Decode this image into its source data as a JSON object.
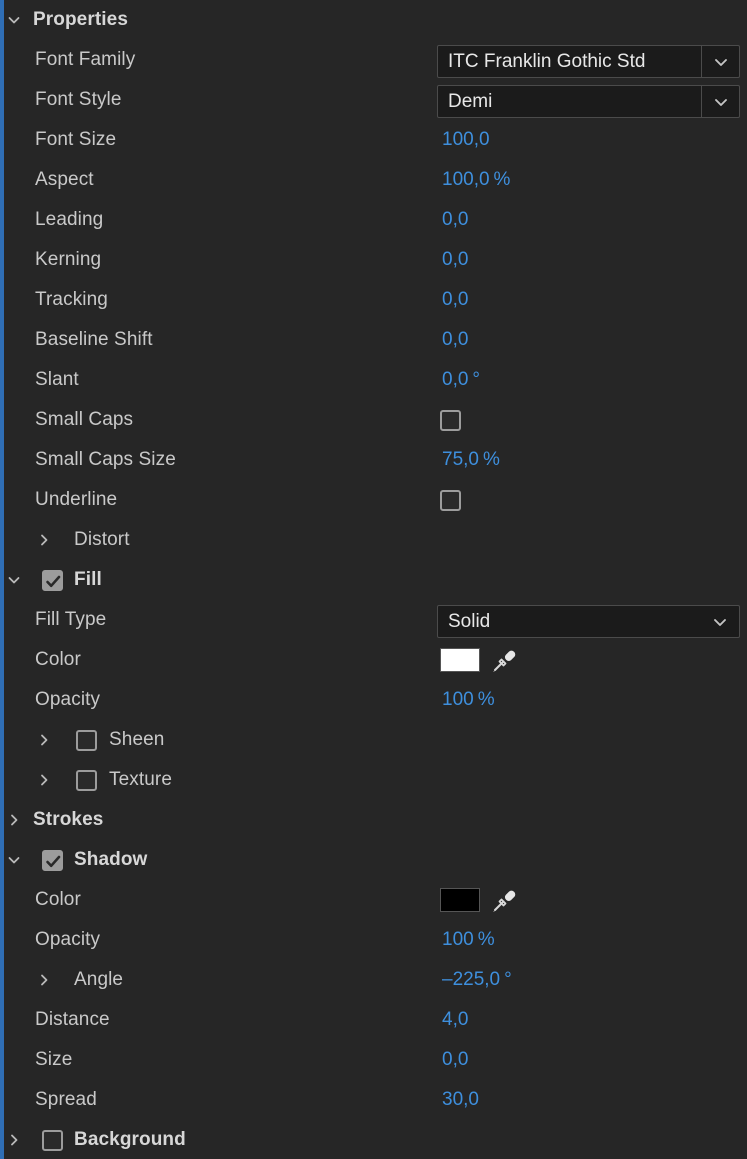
{
  "panel": {
    "title": "Properties",
    "accent_color": "#2f6eb5",
    "background_color": "#262626",
    "value_color": "#3e8fdd",
    "label_color": "#c9c9c9"
  },
  "rows": [
    {
      "label": "Properties",
      "kind": "section-header",
      "expanded": true,
      "chevron": "chevron-down-icon"
    },
    {
      "label": "Font Family",
      "kind": "dropdown",
      "value": "ITC Franklin Gothic Std",
      "split": true
    },
    {
      "label": "Font Style",
      "kind": "dropdown",
      "value": "Demi",
      "split": true
    },
    {
      "label": "Font Size",
      "kind": "value",
      "value": "100,0"
    },
    {
      "label": "Aspect",
      "kind": "value",
      "value": "100,0",
      "unit": "%"
    },
    {
      "label": "Leading",
      "kind": "value",
      "value": "0,0"
    },
    {
      "label": "Kerning",
      "kind": "value",
      "value": "0,0"
    },
    {
      "label": "Tracking",
      "kind": "value",
      "value": "0,0"
    },
    {
      "label": "Baseline Shift",
      "kind": "value",
      "value": "0,0"
    },
    {
      "label": "Slant",
      "kind": "value",
      "value": "0,0",
      "unit": "°"
    },
    {
      "label": "Small Caps",
      "kind": "checkbox-value",
      "checked": false
    },
    {
      "label": "Small Caps Size",
      "kind": "value",
      "value": "75,0",
      "unit": "%"
    },
    {
      "label": "Underline",
      "kind": "checkbox-value",
      "checked": false
    },
    {
      "label": "Distort",
      "kind": "sub-group",
      "expanded": false,
      "chevron": "chevron-right-icon"
    },
    {
      "label": "Fill",
      "kind": "section-header-checkbox",
      "expanded": true,
      "checked": true,
      "chevron": "chevron-down-icon"
    },
    {
      "label": "Fill Type",
      "kind": "dropdown",
      "value": "Solid",
      "split": false
    },
    {
      "label": "Color",
      "kind": "color",
      "swatch": "#ffffff",
      "eyedropper": "eyedropper-icon"
    },
    {
      "label": "Opacity",
      "kind": "value",
      "value": "100",
      "unit": "%"
    },
    {
      "label": "Sheen",
      "kind": "sub-group-checkbox",
      "expanded": false,
      "checked": false,
      "chevron": "chevron-right-icon"
    },
    {
      "label": "Texture",
      "kind": "sub-group-checkbox",
      "expanded": false,
      "checked": false,
      "chevron": "chevron-right-icon"
    },
    {
      "label": "Strokes",
      "kind": "section-header",
      "expanded": false,
      "chevron": "chevron-right-icon"
    },
    {
      "label": "Shadow",
      "kind": "section-header-checkbox",
      "expanded": true,
      "checked": true,
      "chevron": "chevron-down-icon"
    },
    {
      "label": "Color",
      "kind": "color",
      "swatch": "#000000",
      "eyedropper": "eyedropper-icon"
    },
    {
      "label": "Opacity",
      "kind": "value",
      "value": "100",
      "unit": "%"
    },
    {
      "label": "Angle",
      "kind": "sub-group-value",
      "expanded": false,
      "chevron": "chevron-right-icon",
      "value": "–225,0",
      "unit": "°"
    },
    {
      "label": "Distance",
      "kind": "value",
      "value": "4,0"
    },
    {
      "label": "Size",
      "kind": "value",
      "value": "0,0"
    },
    {
      "label": "Spread",
      "kind": "value",
      "value": "30,0"
    },
    {
      "label": "Background",
      "kind": "section-header-checkbox",
      "expanded": false,
      "checked": false,
      "chevron": "chevron-right-icon"
    }
  ]
}
